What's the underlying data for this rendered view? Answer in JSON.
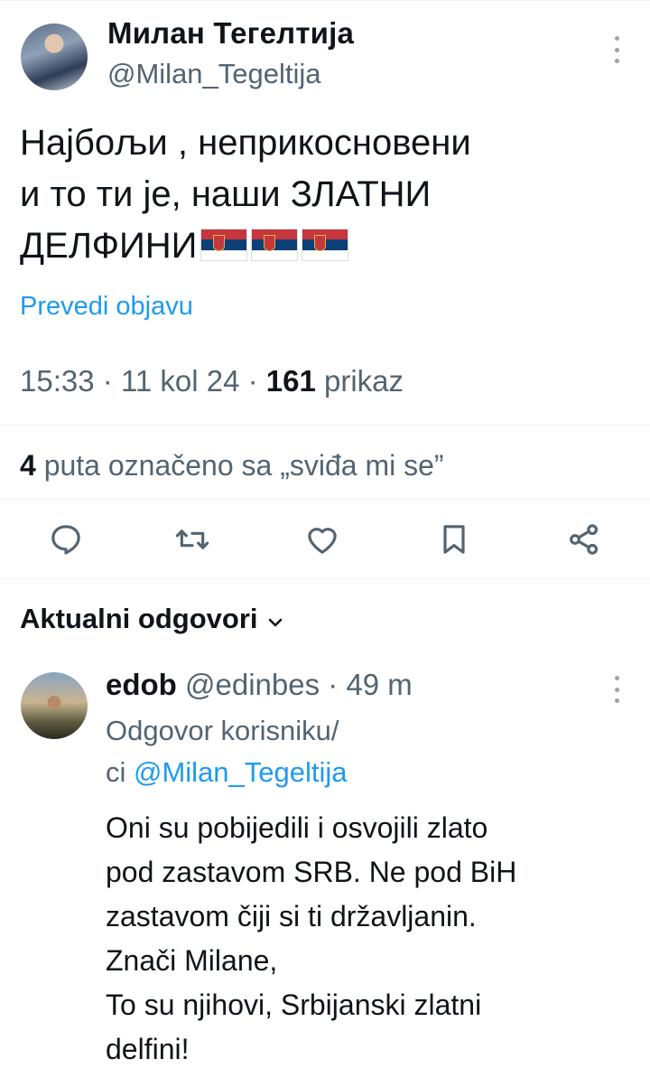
{
  "tweet": {
    "author_name": "Милан Тегелтија",
    "author_handle": "@Milan_Tegeltija",
    "text_line1": "Најбољи , неприкосновени",
    "text_line2": "и то ти је, наши ЗЛАТНИ",
    "text_line3": "ДЕЛФИНИ",
    "flag_icons": [
      "serbia-flag-icon",
      "serbia-flag-icon",
      "serbia-flag-icon"
    ],
    "translate_label": "Prevedi objavu",
    "time": "15:33",
    "date": "11 kol 24",
    "views_count": "161",
    "views_label": "prikaz",
    "likes_count": "4",
    "likes_label": "puta označeno sa „sviđa mi se”"
  },
  "actions": [
    "reply-icon",
    "retweet-icon",
    "like-icon",
    "bookmark-icon",
    "share-icon"
  ],
  "replies_section": {
    "title": "Aktualni odgovori"
  },
  "reply": {
    "author_name": "edob",
    "author_handle": "@edinbes",
    "age": "49 m",
    "reply_to_line1": "Odgovor korisniku/",
    "reply_to_prefix": "ci ",
    "reply_to_handle": "@Milan_Tegeltija",
    "text_lines": [
      "Oni su pobijedili i osvojili zlato",
      "pod zastavom SRB. Ne pod BiH",
      "zastavom čiji si ti državljanin.",
      "Znači Milane,",
      "To su njihovi, Srbijanski zlatni",
      "delfini!"
    ]
  },
  "colors": {
    "accent": "#1d9bf0",
    "secondary_text": "#536471",
    "primary_text": "#0f1419",
    "divider": "#eff3f4"
  }
}
